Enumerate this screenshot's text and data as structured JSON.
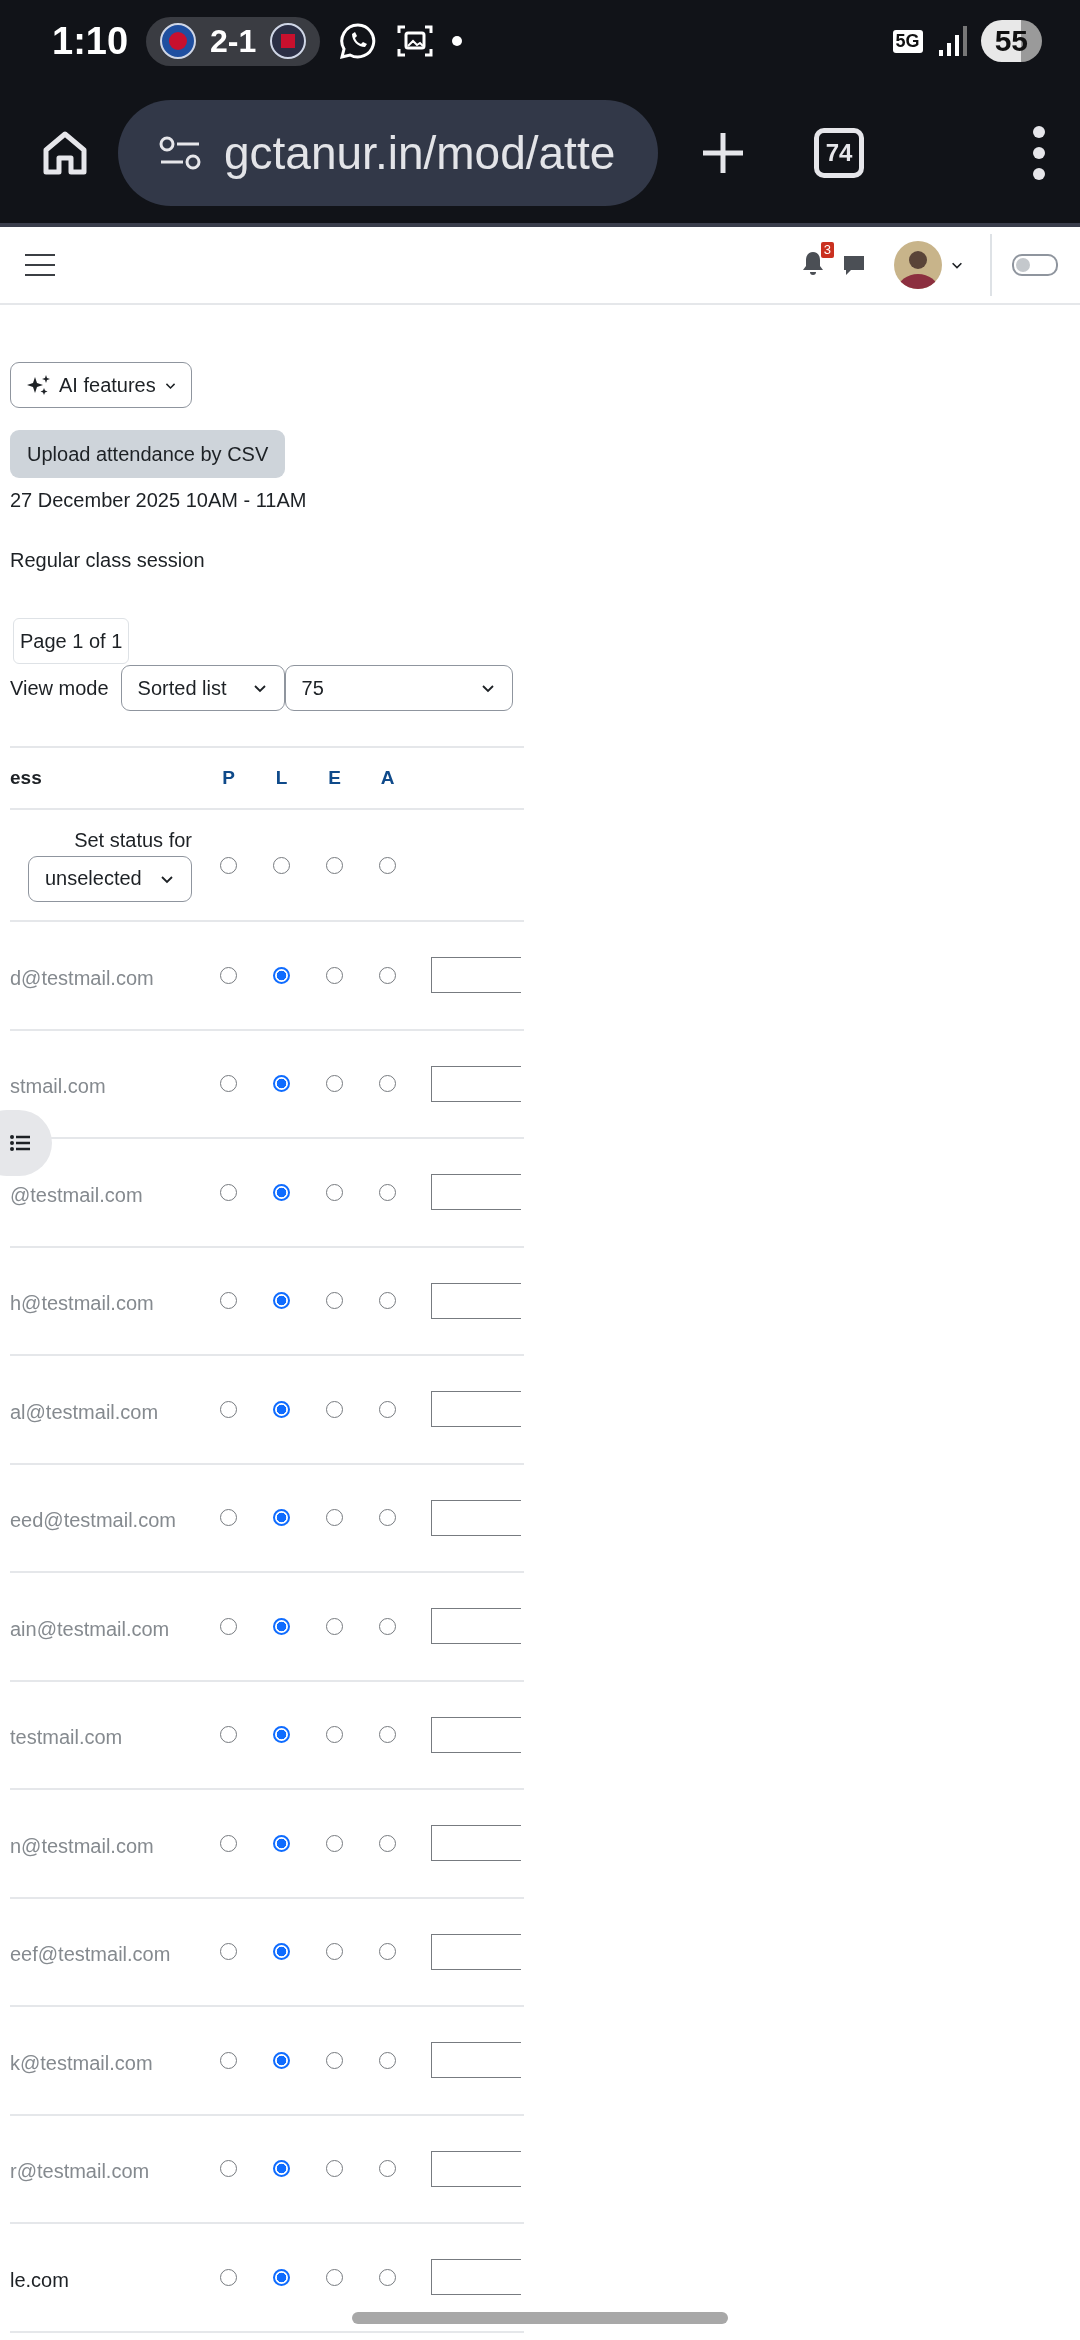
{
  "status_bar": {
    "time": "1:10",
    "score": "2-1",
    "network": "5G",
    "battery": "55"
  },
  "browser": {
    "url": "gctanur.in/mod/atte",
    "tab_count": "74"
  },
  "header": {
    "notification_count": "3",
    "dark_mode_on": false
  },
  "ai_button": "AI features",
  "upload_button": "Upload attendance by CSV",
  "session_date": "27 December 2025 10AM - 11AM",
  "session_description": "Regular class session",
  "pagination": "Page 1 of 1",
  "view_mode": {
    "label": "View mode",
    "mode": "Sorted list",
    "per_page": "75"
  },
  "table": {
    "columns": [
      "ess",
      "P",
      "L",
      "E",
      "A"
    ],
    "set_status": {
      "label": "Set status for",
      "scope": "unselected",
      "options": [
        {
          "selected": false
        },
        {
          "selected": false
        },
        {
          "selected": false
        },
        {
          "selected": false
        }
      ]
    },
    "rows": [
      {
        "email": "d@testmail.com",
        "greyed": true,
        "options": [
          {
            "selected": false
          },
          {
            "selected": true
          },
          {
            "selected": false
          },
          {
            "selected": false
          }
        ]
      },
      {
        "email": "stmail.com",
        "greyed": true,
        "options": [
          {
            "selected": false
          },
          {
            "selected": true
          },
          {
            "selected": false
          },
          {
            "selected": false
          }
        ]
      },
      {
        "email": "@testmail.com",
        "greyed": true,
        "options": [
          {
            "selected": false
          },
          {
            "selected": true
          },
          {
            "selected": false
          },
          {
            "selected": false
          }
        ]
      },
      {
        "email": "h@testmail.com",
        "greyed": true,
        "options": [
          {
            "selected": false
          },
          {
            "selected": true
          },
          {
            "selected": false
          },
          {
            "selected": false
          }
        ]
      },
      {
        "email": "al@testmail.com",
        "greyed": true,
        "options": [
          {
            "selected": false
          },
          {
            "selected": true
          },
          {
            "selected": false
          },
          {
            "selected": false
          }
        ]
      },
      {
        "email": "eed@testmail.com",
        "greyed": true,
        "options": [
          {
            "selected": false
          },
          {
            "selected": true
          },
          {
            "selected": false
          },
          {
            "selected": false
          }
        ]
      },
      {
        "email": "ain@testmail.com",
        "greyed": true,
        "options": [
          {
            "selected": false
          },
          {
            "selected": true
          },
          {
            "selected": false
          },
          {
            "selected": false
          }
        ]
      },
      {
        "email": "testmail.com",
        "greyed": true,
        "options": [
          {
            "selected": false
          },
          {
            "selected": true
          },
          {
            "selected": false
          },
          {
            "selected": false
          }
        ]
      },
      {
        "email": "n@testmail.com",
        "greyed": true,
        "options": [
          {
            "selected": false
          },
          {
            "selected": true
          },
          {
            "selected": false
          },
          {
            "selected": false
          }
        ]
      },
      {
        "email": "eef@testmail.com",
        "greyed": true,
        "options": [
          {
            "selected": false
          },
          {
            "selected": true
          },
          {
            "selected": false
          },
          {
            "selected": false
          }
        ]
      },
      {
        "email": "k@testmail.com",
        "greyed": true,
        "options": [
          {
            "selected": false
          },
          {
            "selected": true
          },
          {
            "selected": false
          },
          {
            "selected": false
          }
        ]
      },
      {
        "email": "r@testmail.com",
        "greyed": true,
        "options": [
          {
            "selected": false
          },
          {
            "selected": true
          },
          {
            "selected": false
          },
          {
            "selected": false
          }
        ]
      },
      {
        "email": "le.com",
        "greyed": false,
        "options": [
          {
            "selected": false
          },
          {
            "selected": true
          },
          {
            "selected": false
          },
          {
            "selected": false
          }
        ]
      }
    ]
  }
}
